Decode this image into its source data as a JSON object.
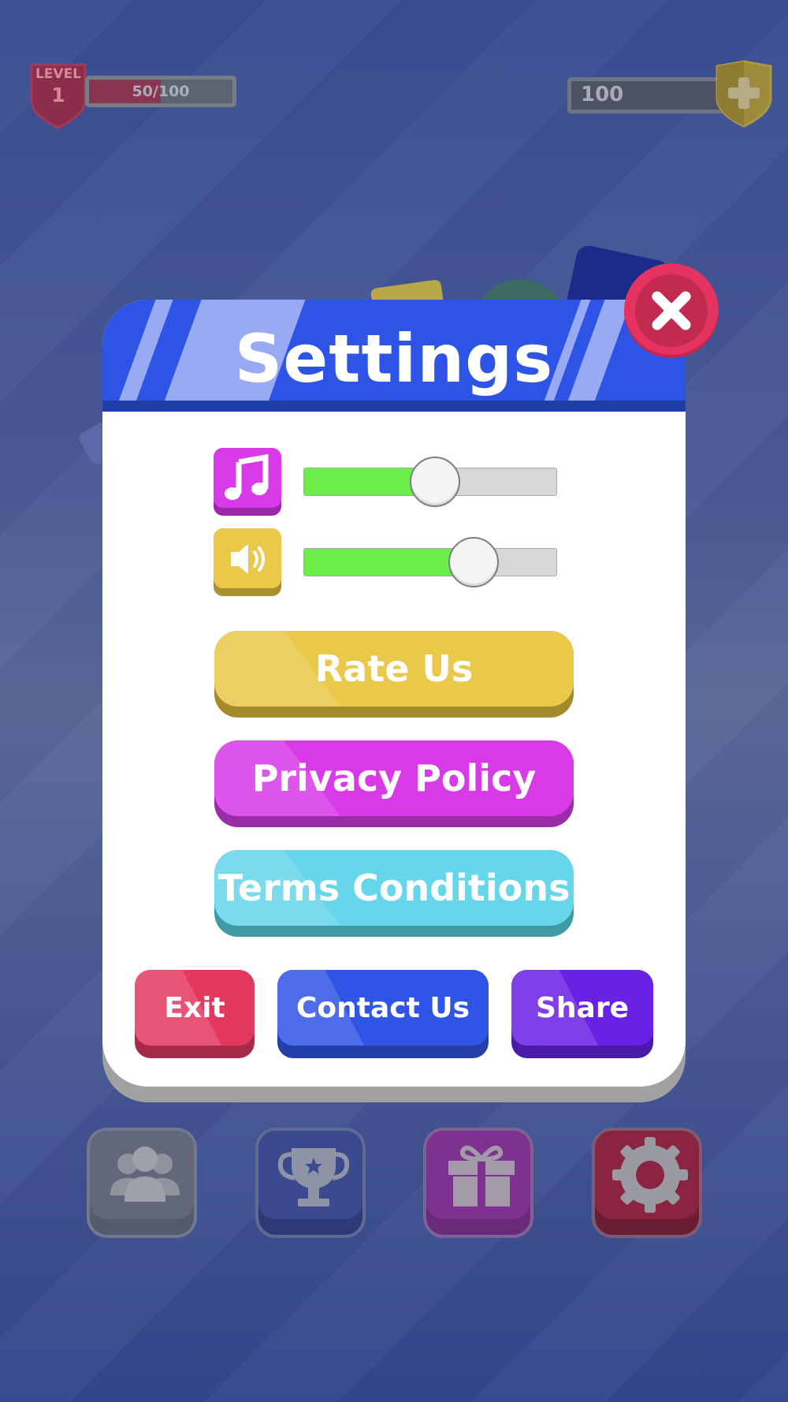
{
  "hud": {
    "level_label": "LEVEL",
    "level_number": "1",
    "xp_text": "50/100",
    "xp_progress": 0.5,
    "coins": "100",
    "coin_add_icon": "plus-icon"
  },
  "settings": {
    "title": "Settings",
    "close_icon": "close-icon",
    "music": {
      "icon": "music-note-icon",
      "level": 0.52,
      "color": "#d93ae8"
    },
    "sound": {
      "icon": "speaker-icon",
      "level": 0.67,
      "color": "#e9c84a"
    },
    "buttons": {
      "rate": "Rate Us",
      "privacy": "Privacy Policy",
      "terms": "Terms Conditions",
      "exit": "Exit",
      "contact": "Contact Us",
      "share": "Share"
    }
  },
  "nav": [
    {
      "icon": "friends-icon"
    },
    {
      "icon": "trophy-icon"
    },
    {
      "icon": "gift-icon"
    },
    {
      "icon": "gear-icon"
    }
  ],
  "colors": {
    "header_blue": "#2e54e6",
    "close_red": "#e4335e",
    "rate_yellow": "#e9c84a",
    "privacy_magenta": "#d93ae8",
    "terms_cyan": "#66d6ea",
    "exit_red": "#e4385f",
    "contact_blue": "#3055e6",
    "share_purple": "#6a21e6",
    "slider_green": "#6cee4a"
  }
}
